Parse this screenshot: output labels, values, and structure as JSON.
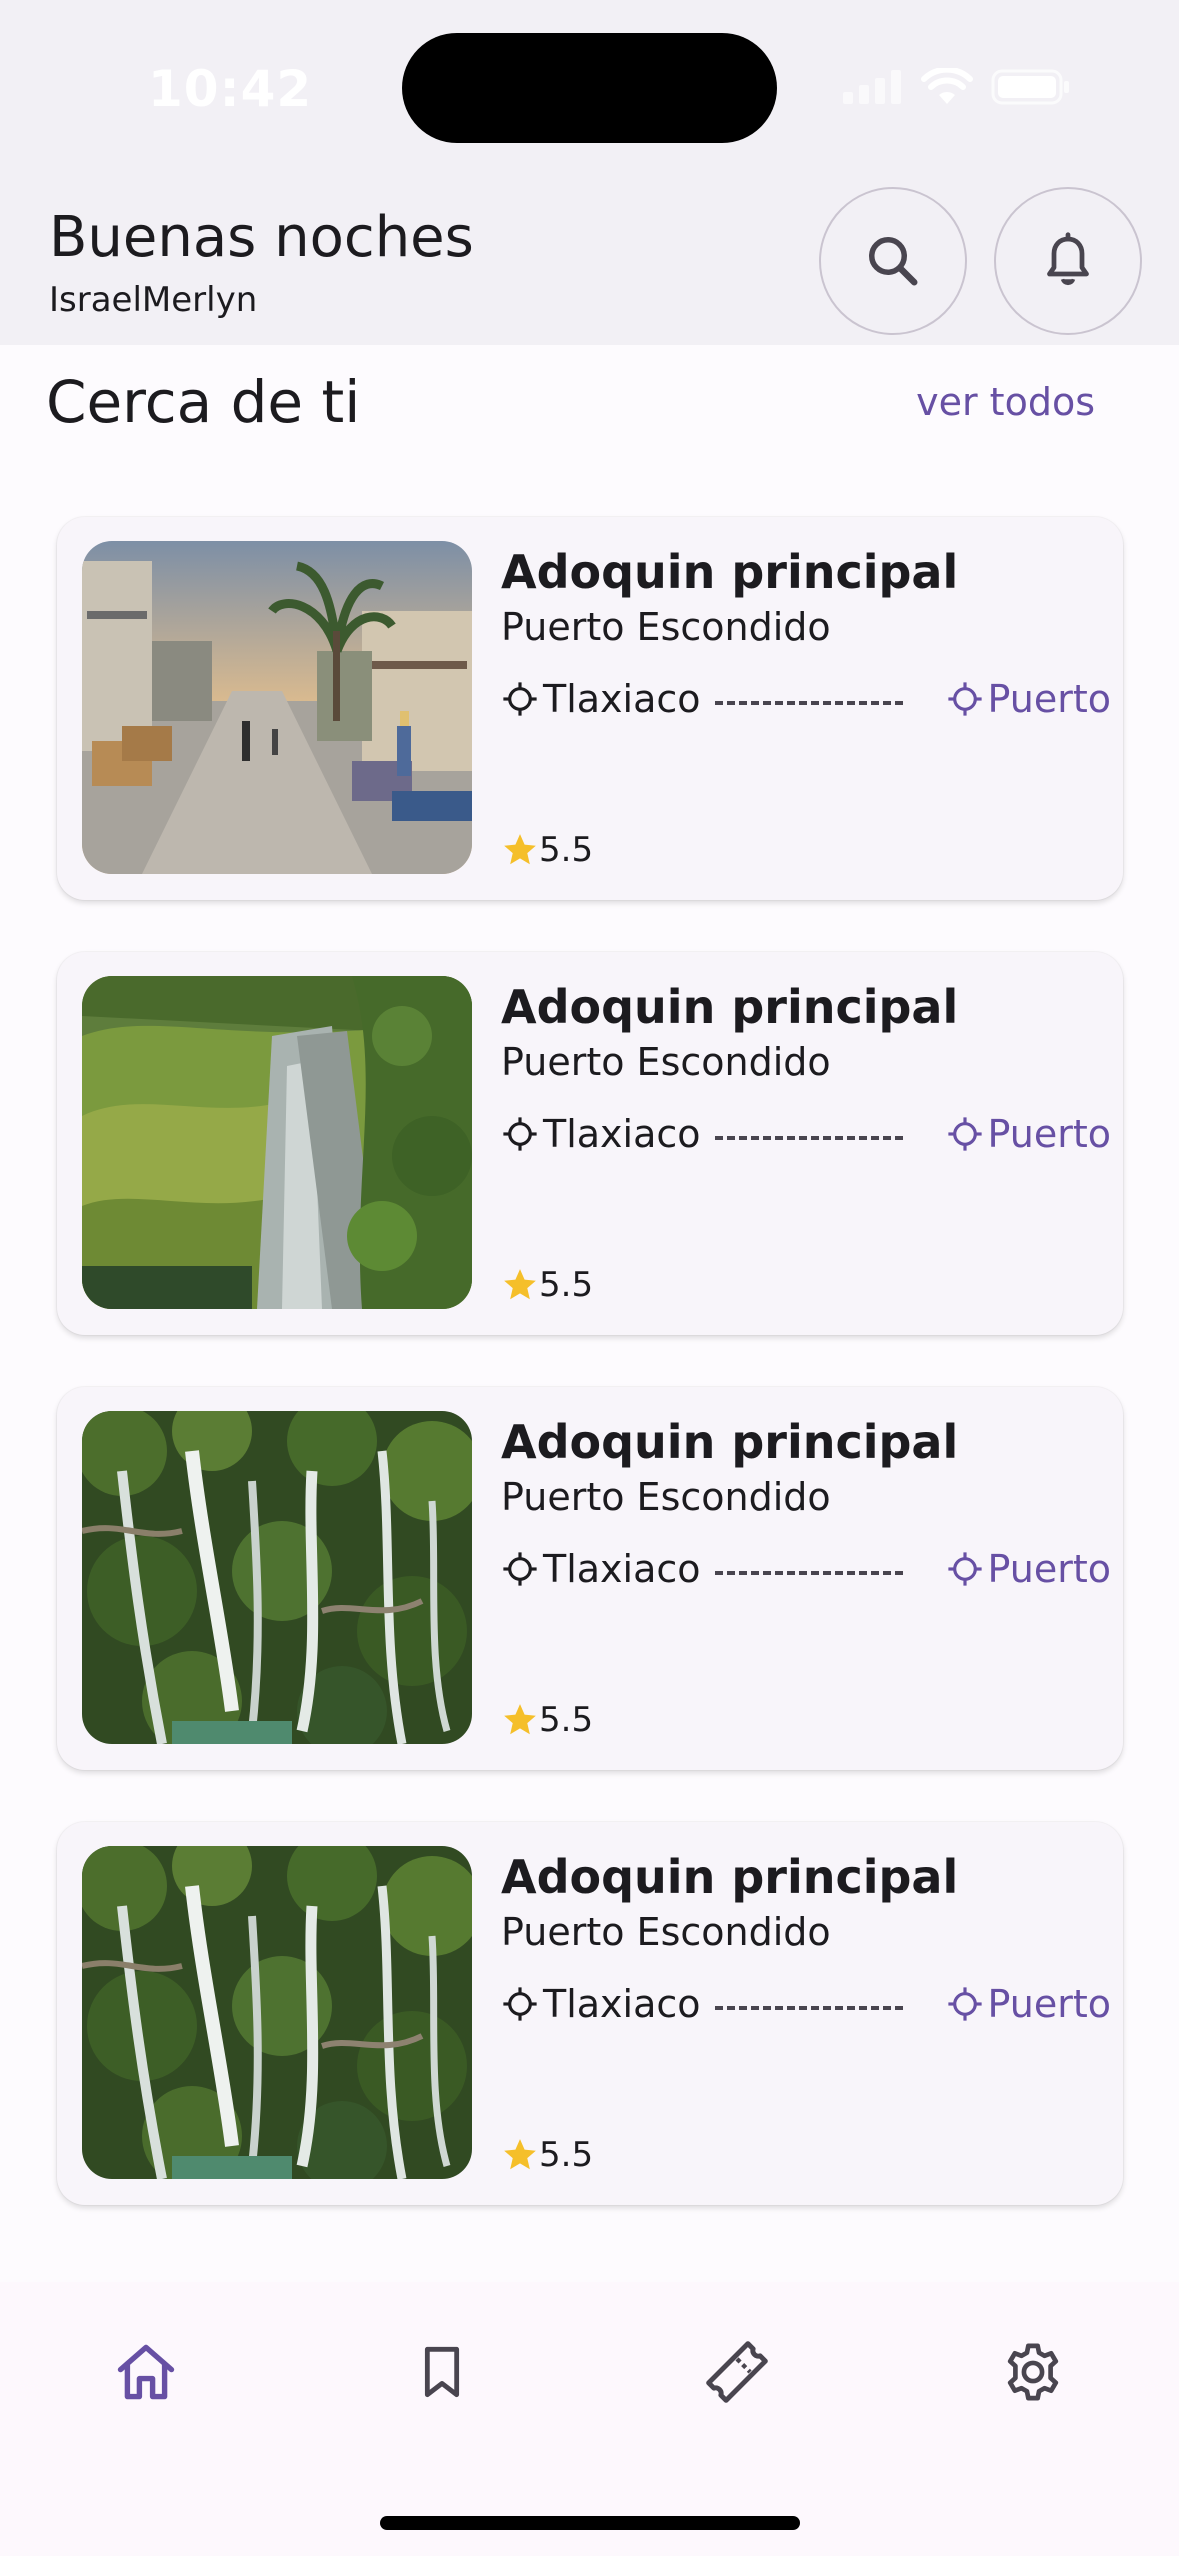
{
  "status_bar": {
    "time": "10:42"
  },
  "header": {
    "greeting": "Buenas noches",
    "username": "IsraelMerlyn"
  },
  "section": {
    "title": "Cerca de ti",
    "see_all": "ver todos"
  },
  "places": [
    {
      "title": "Adoquin principal",
      "subtitle": "Puerto Escondido",
      "origin": "Tlaxiaco",
      "destination": "Puerto",
      "rating": "5.5",
      "image": "street-market-photo"
    },
    {
      "title": "Adoquin principal",
      "subtitle": "Puerto Escondido",
      "origin": "Tlaxiaco",
      "destination": "Puerto",
      "rating": "5.5",
      "image": "petrified-waterfall-photo"
    },
    {
      "title": "Adoquin principal",
      "subtitle": "Puerto Escondido",
      "origin": "Tlaxiaco",
      "destination": "Puerto",
      "rating": "5.5",
      "image": "waterfall-aerial-photo"
    },
    {
      "title": "Adoquin principal",
      "subtitle": "Puerto Escondido",
      "origin": "Tlaxiaco",
      "destination": "Puerto",
      "rating": "5.5",
      "image": "waterfall-aerial-photo"
    }
  ],
  "bottom_nav": [
    {
      "icon": "home-icon",
      "active": true
    },
    {
      "icon": "bookmark-icon",
      "active": false
    },
    {
      "icon": "ticket-icon",
      "active": false
    },
    {
      "icon": "settings-icon",
      "active": false
    }
  ],
  "colors": {
    "accent": "#6750a4",
    "star": "#f5bf2a",
    "header_bg": "#f2f0f5",
    "card_bg": "#f8f5fa"
  }
}
